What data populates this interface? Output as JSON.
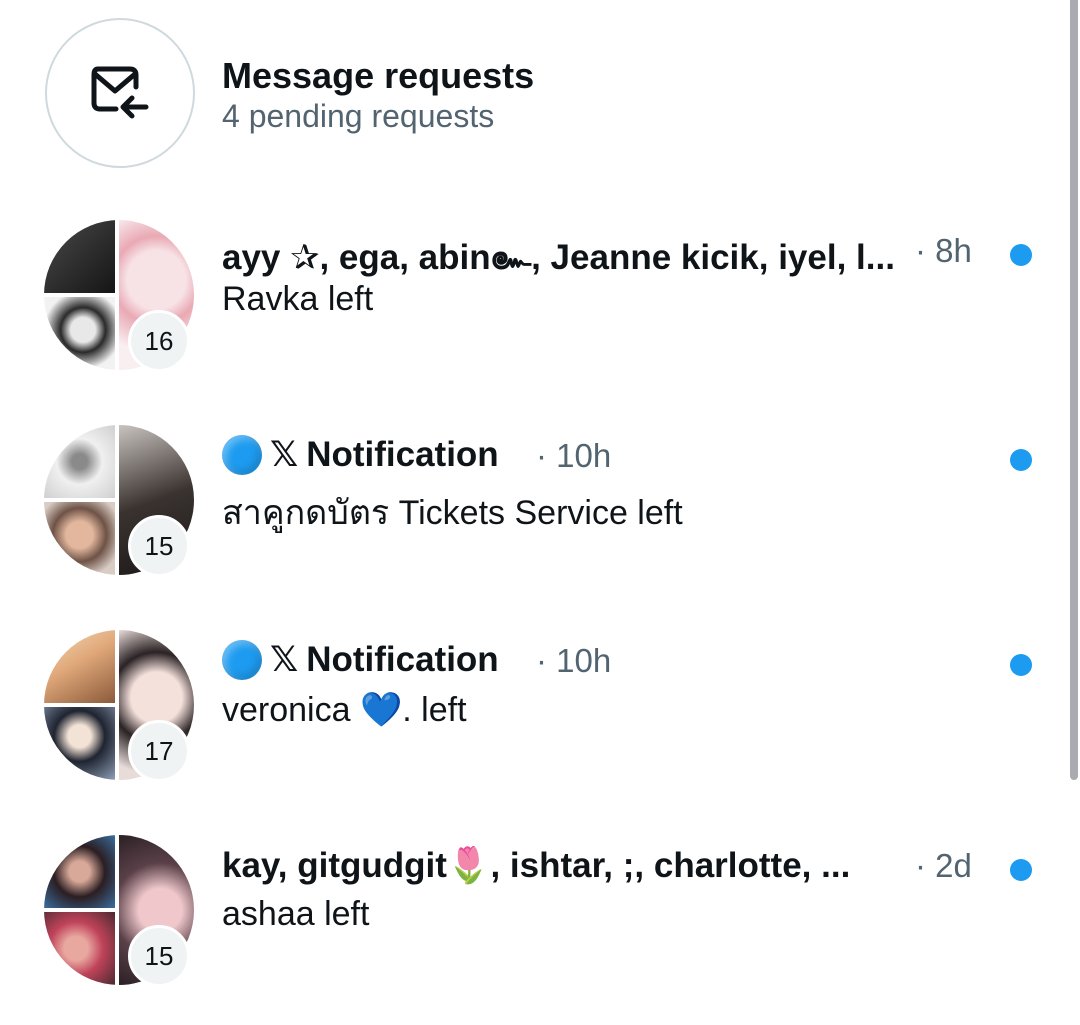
{
  "requests": {
    "title": "Message requests",
    "subtitle": "4 pending requests",
    "icon": "mail-inbox-arrow-icon"
  },
  "conversations": [
    {
      "title": "ayy ✰, ega, abin๛, Jeanne kicik, iyel, l...",
      "time": "· 8h",
      "message": "Ravka left",
      "count": "16",
      "unread": true,
      "tiles": [
        "#2a2a2a",
        "#1c1c1c",
        "#f3d7dc"
      ]
    },
    {
      "prefix_icon": "blue-circle-emoji",
      "x_icon": "𝕏",
      "title": "Notification",
      "time": "· 10h",
      "message": "สาคูกดบัตร Tickets Service left",
      "count": "15",
      "unread": true,
      "tiles": [
        "#d9d9d9",
        "#c7a894",
        "#3a3330"
      ]
    },
    {
      "prefix_icon": "blue-circle-emoji",
      "x_icon": "𝕏",
      "title": "Notification",
      "time": "· 10h",
      "message": "veronica 💙. left",
      "count": "17",
      "unread": true,
      "tiles": [
        "#e6b98c",
        "#2c3038",
        "#d8c8c4"
      ]
    },
    {
      "title": "kay, gitgudgit🌷, ishtar, ;, charlotte, ...",
      "time": "· 2d",
      "message": "ashaa left",
      "count": "15",
      "unread": true,
      "tiles": [
        "#2b1e22",
        "#c0435a",
        "#5a4048"
      ]
    }
  ],
  "colors": {
    "accent": "#1d9bf0",
    "secondary_text": "#536471",
    "badge_bg": "#eff3f4"
  }
}
